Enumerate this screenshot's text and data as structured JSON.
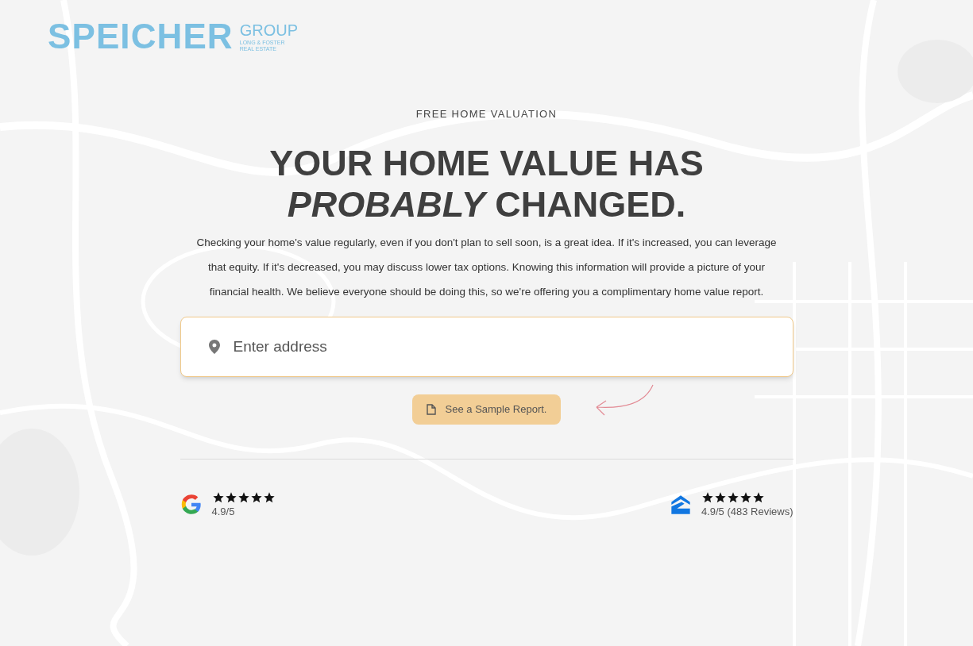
{
  "logo": {
    "name": "SPEICHER",
    "group": "GROUP",
    "sub1": "LONG & FOSTER",
    "sub2": "REAL ESTATE"
  },
  "eyebrow": "FREE HOME VALUATION",
  "headline": [
    "YOUR HOME VALUE HAS",
    "*PROBABLY* CHANGED."
  ],
  "intro": "Checking your home's value regularly, even if you don't plan to sell soon, is a great idea. If it's increased, you can leverage that equity. If it's decreased, you may discuss lower tax options. Knowing this information will provide a picture of your financial health. We believe everyone should be doing this, so we're offering you a complimentary home value report.",
  "address_field": {
    "placeholder": "Enter address"
  },
  "sample_button": "See a Sample Report.",
  "reviews": [
    {
      "kind": "google",
      "stars": 5,
      "rating": "4.9/5"
    },
    {
      "kind": "zillow",
      "stars": 5,
      "rating": "4.9/5 (483 Reviews)"
    }
  ]
}
